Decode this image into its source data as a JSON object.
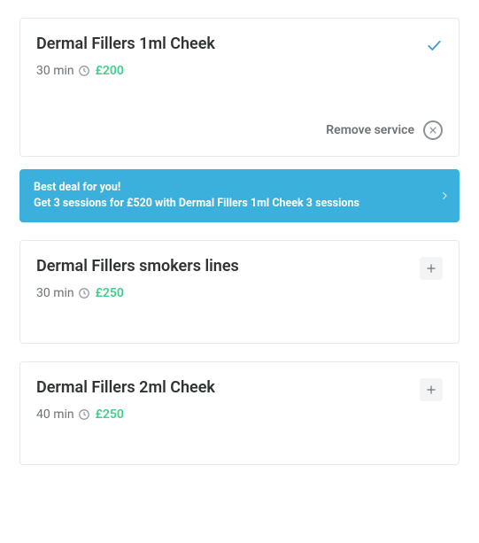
{
  "services": [
    {
      "title": "Dermal Fillers 1ml Cheek",
      "duration": "30 min",
      "price": "£200",
      "selected": true
    },
    {
      "title": "Dermal Fillers smokers lines",
      "duration": "30 min",
      "price": "£250",
      "selected": false
    },
    {
      "title": "Dermal Fillers 2ml Cheek",
      "duration": "40 min",
      "price": "£250",
      "selected": false
    }
  ],
  "remove_label": "Remove service",
  "bundle": {
    "headline": "Best deal for you!",
    "detail": "Get 3 sessions for £520 with Dermal Fillers 1ml Cheek 3 sessions"
  }
}
